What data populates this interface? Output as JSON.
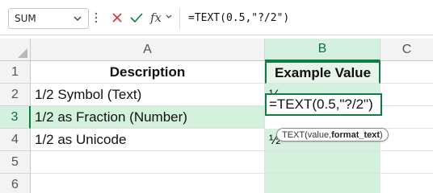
{
  "formula_bar": {
    "name_box": "SUM",
    "fx_label": "fx",
    "formula": "=TEXT(0.5,\"?/2\")"
  },
  "columns": [
    {
      "label": "A",
      "selected": false
    },
    {
      "label": "B",
      "selected": true
    },
    {
      "label": "C",
      "selected": false
    }
  ],
  "rows": [
    {
      "num": "1",
      "a": "Description",
      "b": "Example Value"
    },
    {
      "num": "2",
      "a": "1/2 Symbol (Text)",
      "b": "½"
    },
    {
      "num": "3",
      "a": "1/2 as Fraction (Number)",
      "b": "=TEXT(0.5,\"?/2\")"
    },
    {
      "num": "4",
      "a": "1/2 as Unicode",
      "b": "½"
    },
    {
      "num": "5",
      "a": "",
      "b": ""
    },
    {
      "num": "6",
      "a": "",
      "b": ""
    }
  ],
  "tooltip": {
    "func": "TEXT(value, ",
    "arg_bold": "format_text",
    "close": ")"
  },
  "colors": {
    "accent": "#107c41",
    "selected_fill": "#d4f1dd",
    "cancel_red": "#d13438"
  }
}
